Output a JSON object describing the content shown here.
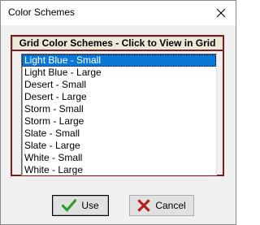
{
  "window": {
    "title": "Color Schemes",
    "close_glyph": "✕"
  },
  "header": {
    "text": "Grid Color Schemes - Click to View in Grid"
  },
  "list": {
    "selected_index": 0,
    "items": [
      "Light Blue - Small",
      "Light Blue - Large",
      "Desert - Small",
      "Desert - Large",
      "Storm - Small",
      "Storm - Large",
      "Slate - Small",
      "Slate - Large",
      "White - Small",
      "White - Large"
    ]
  },
  "buttons": {
    "use_label": "Use",
    "cancel_label": "Cancel"
  },
  "colors": {
    "selection": "#0a78d7",
    "frame": "#7b1e1e",
    "check": "#2e9e2e",
    "cross": "#b22020"
  }
}
